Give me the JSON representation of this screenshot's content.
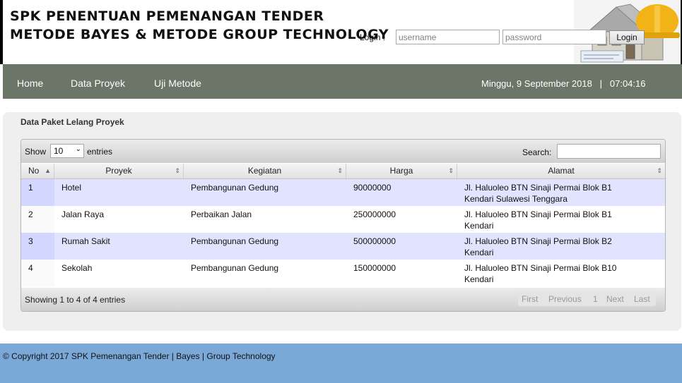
{
  "header": {
    "title_line1": "SPK PENENTUAN PEMENANGAN TENDER",
    "title_line2": "METODE BAYES & METODE GROUP TECHNOLOGY",
    "login_label": "Login :",
    "username_placeholder": "username",
    "password_placeholder": "password",
    "login_button": "Login"
  },
  "nav": {
    "items": [
      {
        "label": "Home"
      },
      {
        "label": "Data Proyek"
      },
      {
        "label": "Uji Metode"
      }
    ],
    "datetime": "Minggu, 9 September 2018   |   07:04:16"
  },
  "panel": {
    "title": "Data Paket Lelang Proyek",
    "show_label": "Show",
    "show_value": "10",
    "entries_label": "entries",
    "search_label": "Search:",
    "columns": [
      "No",
      "Proyek",
      "Kegiatan",
      "Harga",
      "Alamat"
    ],
    "rows": [
      {
        "no": "1",
        "proyek": "Hotel",
        "kegiatan": "Pembangunan Gedung",
        "harga": "90000000",
        "alamat1": "Jl. Haluoleo BTN Sinaji Permai Blok B1",
        "alamat2": "Kendari Sulawesi Tenggara"
      },
      {
        "no": "2",
        "proyek": "Jalan Raya",
        "kegiatan": "Perbaikan Jalan",
        "harga": "250000000",
        "alamat1": "Jl. Haluoleo BTN Sinaji Permai Blok B1",
        "alamat2": "Kendari"
      },
      {
        "no": "3",
        "proyek": "Rumah Sakit",
        "kegiatan": "Pembangunan Gedung",
        "harga": "500000000",
        "alamat1": "Jl. Haluoleo BTN Sinaji Permai Blok B2",
        "alamat2": "Kendari"
      },
      {
        "no": "4",
        "proyek": "Sekolah",
        "kegiatan": "Pembangunan Gedung",
        "harga": "150000000",
        "alamat1": "Jl. Haluoleo BTN Sinaji Permai Blok B10",
        "alamat2": "Kendari"
      }
    ],
    "info": "Showing 1 to 4 of 4 entries",
    "pager": {
      "first": "First",
      "previous": "Previous",
      "page": "1",
      "next": "Next",
      "last": "Last"
    }
  },
  "footer": {
    "text": "© Copyright 2017 SPK Pemenangan Tender | Bayes | Group Technology"
  },
  "colors": {
    "nav_bg": "#6b7568",
    "footer_bg": "#7aa9d8",
    "row_odd": "#e2e4ff"
  }
}
